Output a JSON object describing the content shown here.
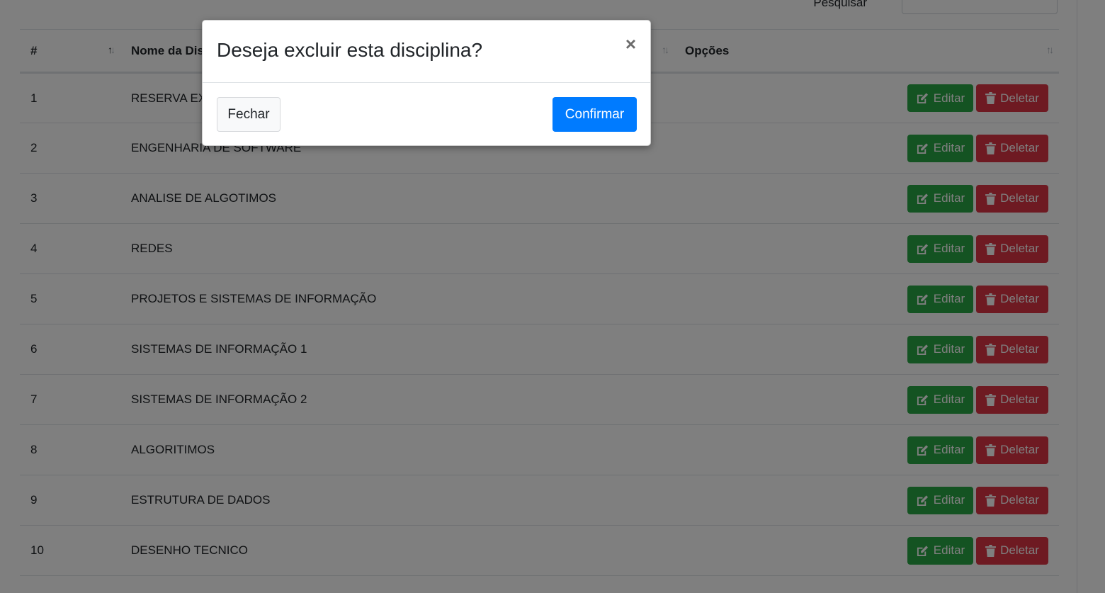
{
  "search": {
    "label": "Pesquisar",
    "value": ""
  },
  "table": {
    "headers": {
      "num": "#",
      "name": "Nome da Disciplina",
      "options": "Opções"
    },
    "rows": [
      {
        "num": "1",
        "name": "RESERVA EXTRA"
      },
      {
        "num": "2",
        "name": "ENGENHARIA DE SOFTWARE"
      },
      {
        "num": "3",
        "name": "ANALISE DE ALGOTIMOS"
      },
      {
        "num": "4",
        "name": "REDES"
      },
      {
        "num": "5",
        "name": "PROJETOS E SISTEMAS DE INFORMAÇÃO"
      },
      {
        "num": "6",
        "name": "SISTEMAS DE INFORMAÇÃO 1"
      },
      {
        "num": "7",
        "name": "SISTEMAS DE INFORMAÇÃO 2"
      },
      {
        "num": "8",
        "name": "ALGORITIMOS"
      },
      {
        "num": "9",
        "name": "ESTRUTURA DE DADOS"
      },
      {
        "num": "10",
        "name": "DESENHO TECNICO"
      }
    ],
    "edit_label": "Editar",
    "delete_label": "Deletar"
  },
  "modal": {
    "title": "Deseja excluir esta disciplina?",
    "close_symbol": "×",
    "cancel_label": "Fechar",
    "confirm_label": "Confirmar"
  },
  "icons": {
    "sort": "sort-icon",
    "edit": "edit-icon",
    "delete": "trash-icon",
    "close": "close-icon"
  },
  "colors": {
    "edit": "#28a745",
    "delete": "#dc3545",
    "confirm": "#007bff",
    "overlay": "rgba(0,0,0,0.5)"
  }
}
